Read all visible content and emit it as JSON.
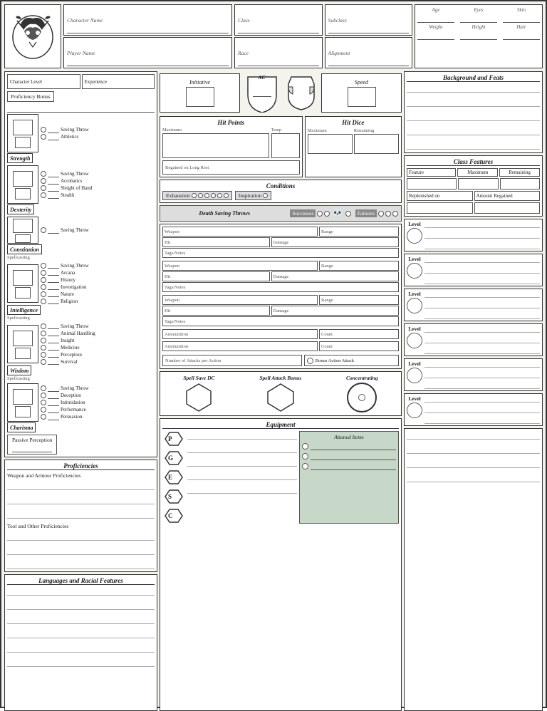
{
  "header": {
    "character_name_label": "Character Name",
    "player_name_label": "Player Name",
    "class_label": "Class",
    "subclass_label": "Subclass",
    "race_label": "Race",
    "alignment_label": "Alignment",
    "age_label": "Age",
    "eyes_label": "Eyes",
    "skin_label": "Skin",
    "weight_label": "Weight",
    "height_label": "Height",
    "hair_label": "Hair"
  },
  "stats": {
    "char_level_label": "Character Level",
    "experience_label": "Experience",
    "prof_bonus_label": "Proficiency Bonus",
    "strength_label": "Strength",
    "dexterity_label": "Dexterity",
    "constitution_label": "Constitution",
    "intelligence_label": "Intelligence",
    "wisdom_label": "Wisdom",
    "charisma_label": "Charisma",
    "saving_throw_label": "Saving Throw",
    "athletics_label": "Athletics",
    "acrobatics_label": "Acrobatics",
    "sleight_label": "Sleight of Hand",
    "stealth_label": "Stealth",
    "arcana_label": "Arcana",
    "history_label": "History",
    "investigation_label": "Investigation",
    "nature_label": "Nature",
    "religion_label": "Religion",
    "animal_handling_label": "Animal Handling",
    "insight_label": "Insight",
    "medicine_label": "Medicine",
    "perception_label": "Perception",
    "survival_label": "Survival",
    "deception_label": "Deception",
    "intimidation_label": "Intimidation",
    "performance_label": "Performance",
    "persuasion_label": "Persuasion",
    "passive_perception_label": "Passive Perception",
    "spellcasting_label": "Spellcasting"
  },
  "combat": {
    "initiative_label": "Initiative",
    "ac_label": "AC",
    "speed_label": "Speed",
    "hp_label": "Hit Points",
    "hp_max_label": "Maximum",
    "hp_temp_label": "Temp",
    "hp_regained_label": "Regained on Long Rest",
    "hit_dice_label": "Hit Dice",
    "hit_dice_max_label": "Maximum",
    "hit_dice_remaining_label": "Remaining",
    "conditions_label": "Conditions",
    "exhaustion_label": "Exhaustion",
    "inspiration_label": "Inspiration",
    "death_saves_label": "Death Saving Throws",
    "successes_label": "Successes",
    "failures_label": "Failures"
  },
  "weapons": {
    "weapon_label": "Weapon",
    "range_label": "Range",
    "hit_label": "Hit",
    "damage_label": "Damage",
    "tags_notes_label": "Tags/Notes",
    "ammunition_label": "Ammunition",
    "count_label": "Count",
    "attacks_label": "Number of Attacks per Action",
    "bonus_attack_label": "Bonus Action Attack"
  },
  "spells": {
    "spell_save_label": "Spell Save DC",
    "spell_attack_label": "Spell Attack Bonus",
    "concentrating_label": "Concentrating"
  },
  "equipment": {
    "title": "Equipment",
    "pouches": [
      "P",
      "G",
      "E",
      "S",
      "C"
    ],
    "attuned_title": "Attuned Items"
  },
  "right": {
    "bg_feats_title": "Background and Feats",
    "class_features_title": "Class Features",
    "feature_label": "Feature",
    "maximum_label": "Maximum",
    "remaining_label": "Remaining",
    "replenished_on_label": "Replenished on",
    "amount_regained_label": "Amount Regained",
    "level_labels": [
      "Level",
      "Level",
      "Level",
      "Level",
      "Level",
      "Level"
    ]
  },
  "proficiencies": {
    "title": "Proficiencies",
    "weapon_armour_label": "Weapon and Armour Proficiencies",
    "tool_label": "Tool and Other Proficiencies"
  },
  "languages": {
    "title": "Languages and Racial Features"
  }
}
